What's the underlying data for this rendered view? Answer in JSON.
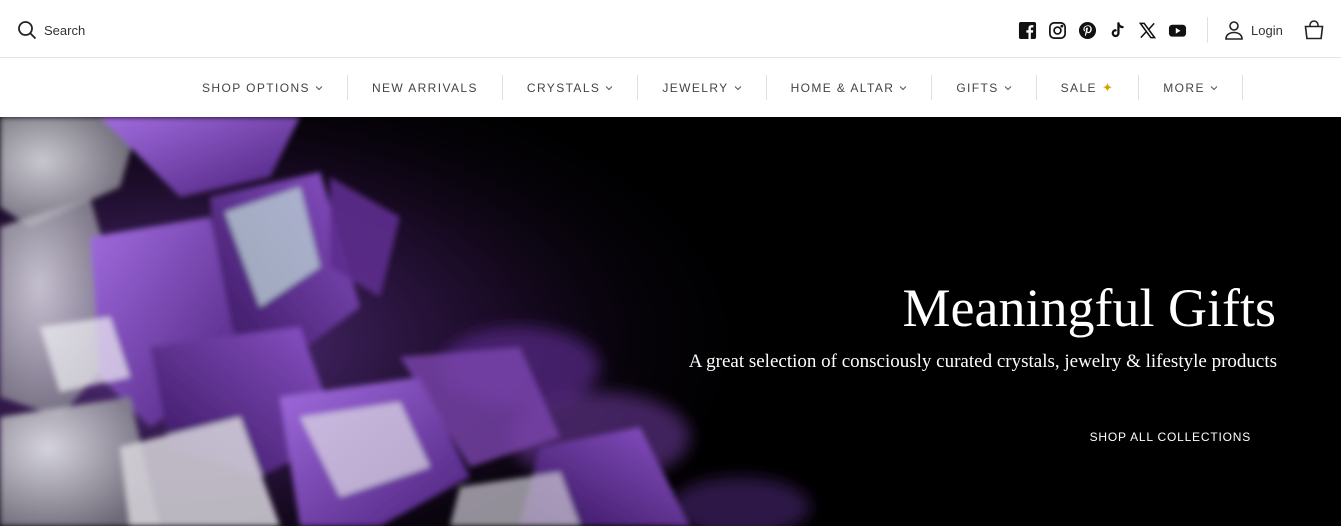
{
  "header": {
    "search_label": "Search",
    "socials": [
      "facebook-icon",
      "instagram-icon",
      "pinterest-icon",
      "tiktok-icon",
      "x-icon",
      "youtube-icon"
    ],
    "login_label": "Login"
  },
  "nav": {
    "items": [
      {
        "label": "SHOP OPTIONS",
        "dropdown": true
      },
      {
        "label": "NEW ARRIVALS",
        "dropdown": false
      },
      {
        "label": "CRYSTALS",
        "dropdown": true
      },
      {
        "label": "JEWELRY",
        "dropdown": true
      },
      {
        "label": "HOME & ALTAR",
        "dropdown": true
      },
      {
        "label": "GIFTS",
        "dropdown": true
      },
      {
        "label": "SALE",
        "dropdown": false,
        "icon": "sparkle-icon"
      },
      {
        "label": "MORE",
        "dropdown": true
      }
    ]
  },
  "hero": {
    "title": "Meaningful Gifts",
    "subtitle": "A great selection of consciously curated crystals, jewelry & lifestyle products",
    "cta": "SHOP ALL COLLECTIONS",
    "colors": {
      "background": "#000000",
      "crystal": "#7a3fb5",
      "text": "#ffffff"
    }
  }
}
